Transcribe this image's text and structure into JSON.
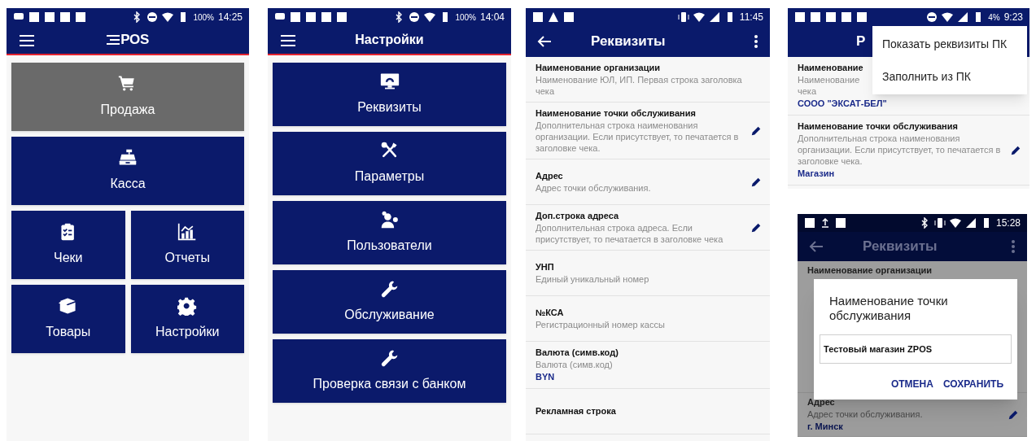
{
  "home_screen": {
    "status_bar": {
      "battery": "100%",
      "time": "14:25"
    },
    "app_bar": {
      "logo_text": "POS"
    },
    "tiles": [
      {
        "label": "Продажа",
        "selected": true,
        "wide": true
      },
      {
        "label": "Касса",
        "selected": false,
        "wide": true
      },
      {
        "label": "Чеки",
        "selected": false,
        "wide": false
      },
      {
        "label": "Отчеты",
        "selected": false,
        "wide": false
      },
      {
        "label": "Товары",
        "selected": false,
        "wide": false
      },
      {
        "label": "Настройки",
        "selected": false,
        "wide": false
      }
    ]
  },
  "settings_screen": {
    "status_bar": {
      "battery": "100%",
      "time": "14:04"
    },
    "app_bar": {
      "title": "Настройки"
    },
    "tiles": [
      {
        "label": "Реквизиты",
        "selected": false,
        "wide": true
      },
      {
        "label": "Параметры",
        "selected": false,
        "wide": true
      },
      {
        "label": "Пользователи",
        "selected": false,
        "wide": true
      },
      {
        "label": "Обслуживание",
        "selected": false,
        "wide": true
      },
      {
        "label": "Проверка связи с банком",
        "selected": false,
        "wide": true
      }
    ]
  },
  "details_screen": {
    "status_bar": {
      "time": "11:45"
    },
    "app_bar": {
      "title": "Реквизиты"
    },
    "rows": [
      {
        "title": "Наименование организации",
        "description": "Наименование ЮЛ, ИП. Первая строка заголовка чека",
        "editable": false
      },
      {
        "title": "Наименование точки обслуживания",
        "description": "Дополнительная строка наименования организации. Если присутствует, то печатается в заголовке чека.",
        "editable": true
      },
      {
        "title": "Адрес",
        "description": "Адрес точки обслуживания.",
        "editable": true
      },
      {
        "title": "Доп.строка адреса",
        "description": "Дополнительная строка адреса. Если присутствует, то печатается в заголовке чека",
        "editable": true
      },
      {
        "title": "УНП",
        "description": "Единый уникальный номер",
        "editable": false
      },
      {
        "title": "№КСА",
        "description": "Регистрационный номер кассы",
        "editable": false
      },
      {
        "title": "Валюта (симв.код)",
        "description": "Валюта (симв.код)",
        "value": "BYN",
        "editable": false
      },
      {
        "title": "Рекламная строка",
        "editable": false
      }
    ]
  },
  "menu_screen": {
    "status_bar": {
      "battery": "4%",
      "time": "9:23"
    },
    "app_bar": {
      "title": "Р"
    },
    "rows": [
      {
        "title": "Наименование",
        "description_lines": [
          "Наименование",
          "чека"
        ],
        "value": "СООО \"ЭКСАТ-БЕЛ\"",
        "editable": false
      },
      {
        "title": "Наименование точки обслуживания",
        "description": "Дополнительная строка наименования организации. Если присутствует, то печатается в заголовке чека.",
        "value": "Магазин",
        "editable": true
      }
    ],
    "menu": [
      "Показать реквизиты ПК",
      "Заполнить из ПК"
    ]
  },
  "dialog_screen": {
    "status_bar": {
      "time": "15:28"
    },
    "app_bar": {
      "title": "Реквизиты"
    },
    "rows": [
      {
        "title": "Наименование организации",
        "editable": false
      },
      {
        "title": "Адрес",
        "description": "Адрес точки обслуживания.",
        "value": "г. Минск",
        "editable": true
      }
    ],
    "dialog": {
      "title": "Наименование точки обслуживания",
      "value": "Тестовый магазин ZPOS",
      "buttons": [
        "ОТМЕНА",
        "СОХРАНИТЬ"
      ]
    }
  }
}
